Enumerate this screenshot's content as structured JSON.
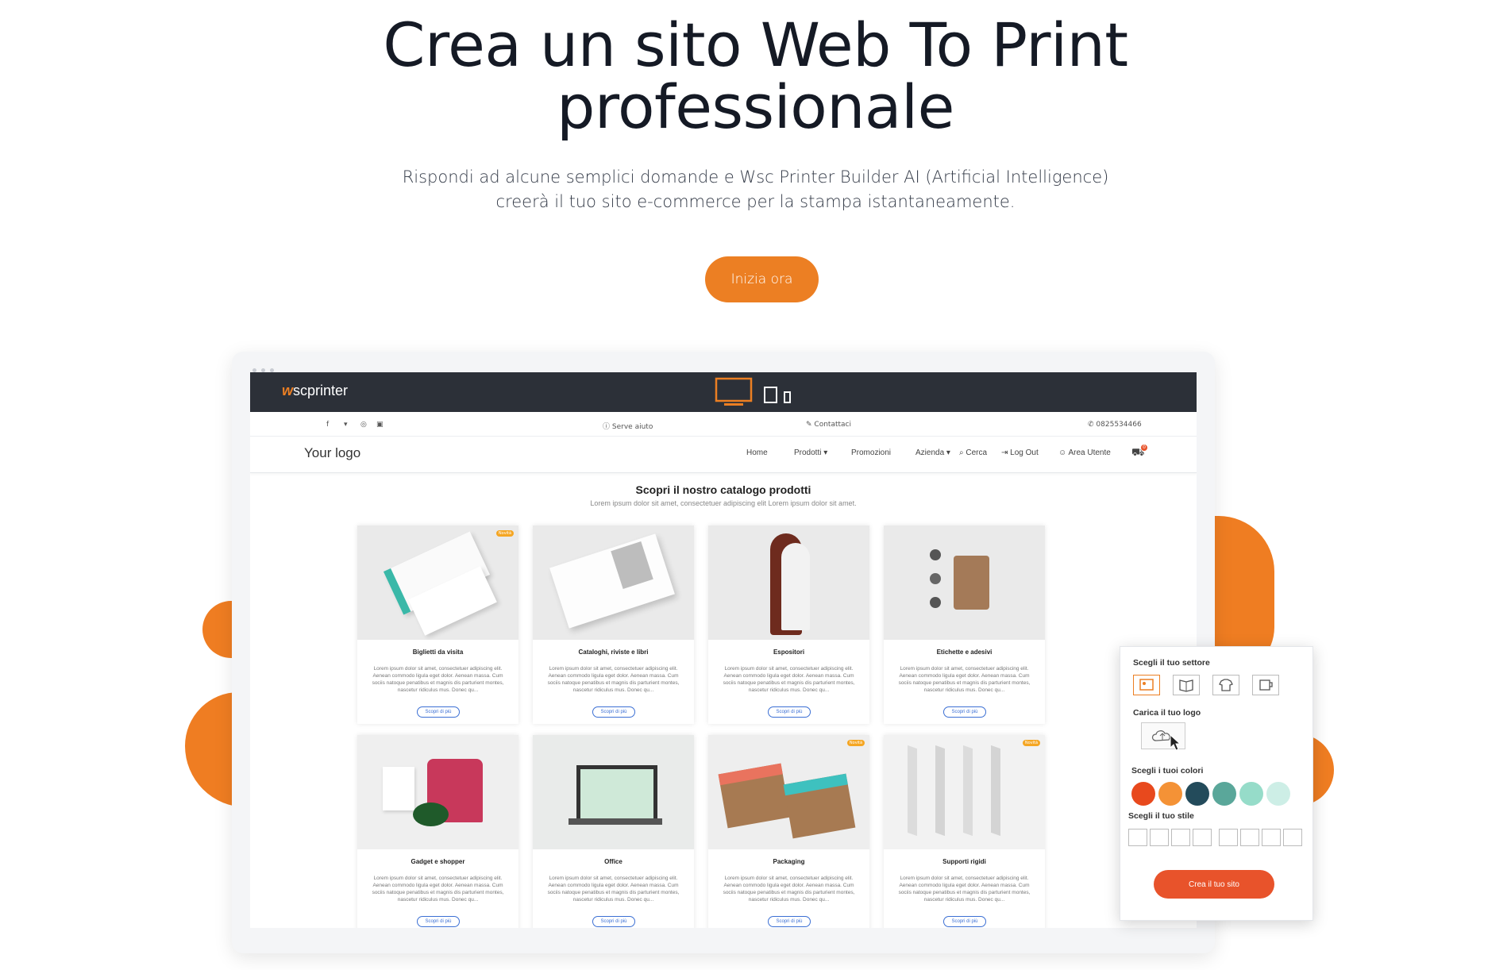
{
  "hero": {
    "title_line1": "Crea un sito Web To Print",
    "title_line2": "professionale",
    "subtitle_line1": "Rispondi ad alcune semplici domande e Wsc Printer Builder AI (Artificial Intelligence)",
    "subtitle_line2": "creerà il tuo sito e-commerce per la stampa istantaneamente.",
    "cta_label": "Inizia ora"
  },
  "colors": {
    "accent": "#ec7f23",
    "dark_bar": "#2c3038",
    "panel_button": "#e8532b",
    "link_blue": "#3b6fd4"
  },
  "mockup": {
    "brand": {
      "prefix": "w",
      "text": "scprinter"
    },
    "devices": [
      "desktop-icon",
      "tablet-icon",
      "mobile-icon"
    ],
    "social_icons": [
      "facebook-icon",
      "twitter-icon",
      "instagram-icon",
      "youtube-icon"
    ],
    "help_text": "Serve aiuto",
    "contact_text": "Contattaci",
    "phone": "0825534466",
    "logo_placeholder": "Your logo",
    "nav": {
      "home": "Home",
      "products": "Prodotti",
      "promotions": "Promozioni",
      "company": "Azienda",
      "search": "Cerca",
      "logout": "Log Out",
      "user_area": "Area Utente",
      "cart_count": "0"
    },
    "catalog_title": "Scopri il nostro catalogo prodotti",
    "catalog_subtitle": "Lorem ipsum dolor sit amet, consectetuer adipiscing elit Lorem ipsum dolor sit amet.",
    "card_desc": "Lorem ipsum dolor sit amet, consectetuer adipiscing elit. Aenean commodo ligula eget dolor. Aenean massa. Cum sociis natoque penatibus et magnis dis parturient montes, nascetur ridiculus mus. Donec qu...",
    "more_label": "Scopri di più",
    "badge_label": "Novità",
    "products": [
      {
        "name": "Biglietti da visita",
        "badge": true
      },
      {
        "name": "Cataloghi, riviste e libri",
        "badge": false
      },
      {
        "name": "Espositori",
        "badge": false
      },
      {
        "name": "Etichette e adesivi",
        "badge": false
      },
      {
        "name": "Gadget e shopper",
        "badge": false
      },
      {
        "name": "Office",
        "badge": false
      },
      {
        "name": "Packaging",
        "badge": true
      },
      {
        "name": "Supporti rigidi",
        "badge": true
      }
    ]
  },
  "builder_panel": {
    "sector_label": "Scegli il tuo settore",
    "sector_icons": [
      "profile-card-icon",
      "book-icon",
      "tshirt-icon",
      "mug-icon"
    ],
    "logo_label": "Carica il tuo logo",
    "colors_label": "Scegli i tuoi colori",
    "swatches": [
      "#e8491d",
      "#f49236",
      "#234b5b",
      "#5aa79a",
      "#96dcc9",
      "#cdeee6"
    ],
    "style_label": "Scegli il tuo stile",
    "button_label": "Crea il tuo sito"
  }
}
